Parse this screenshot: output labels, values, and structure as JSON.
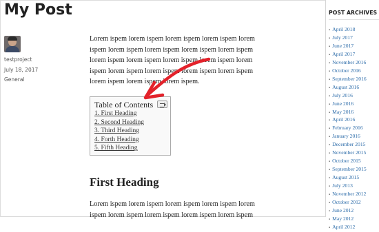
{
  "post": {
    "title": "My Post",
    "author": "testproject",
    "date": "July 18, 2017",
    "category": "General"
  },
  "content": {
    "paragraph1": [
      "Lorem ispem lorem ispem lorem ispem lorem ispem lorem",
      "ispem lorem ispem lorem ispem lorem ispem lorem ispem",
      "lorem ispem lorem ispem lorem ispem lorem ispem lorem",
      "ispem lorem ispem lorem ispem lorem ispem lorem ispem",
      "lorem ispem lorem ispem lorem ispem."
    ],
    "toc": {
      "title": "Table of Contents",
      "items": [
        "1. First Heading",
        "2. Second Heading",
        "3. Third Heading",
        "4. Forth Heading",
        "5. Fifth Heading"
      ]
    },
    "heading1": "First Heading",
    "paragraph2": [
      "Lorem ispem lorem ispem lorem ispem lorem ispem lorem",
      "ispem lorem ispem lorem ispem lorem ispem lorem ispem"
    ]
  },
  "sidebar": {
    "title": "POST ARCHIVES",
    "items": [
      "April 2018",
      "July 2017",
      "June 2017",
      "April 2017",
      "November 2016",
      "October 2016",
      "September 2016",
      "August 2016",
      "July 2016",
      "June 2016",
      "May 2016",
      "April 2016",
      "February 2016",
      "January 2016",
      "December 2015",
      "November 2015",
      "October 2015",
      "September 2015",
      "August 2015",
      "July 2013",
      "November 2012",
      "October 2012",
      "June 2012",
      "May 2012",
      "April 2012"
    ]
  },
  "colors": {
    "link": "#2a6aa8",
    "arrow": "#e3222b"
  },
  "icons": {
    "toc_toggle": "list-toggle-icon",
    "avatar": "user-avatar"
  }
}
